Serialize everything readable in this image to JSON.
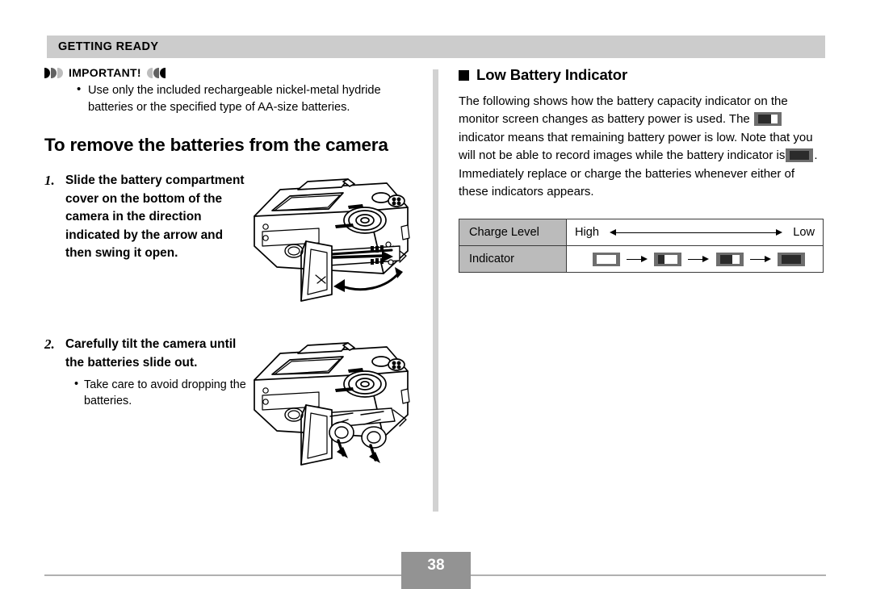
{
  "header": {
    "title": "GETTING READY"
  },
  "left_column": {
    "important": {
      "label": "IMPORTANT!",
      "bullets": [
        "Use only the included rechargeable nickel-metal hydride batteries or the specified type of AA-size batteries."
      ]
    },
    "section_heading": "To remove the batteries from the camera",
    "steps": [
      {
        "number": "1.",
        "text": "Slide the battery compartment cover on the bottom of the camera in the direction indicated by the arrow and then swing it open.",
        "sub": "",
        "illustration": "camera-battery-cover-open-illustration"
      },
      {
        "number": "2.",
        "text": "Carefully tilt the camera until the batteries slide out.",
        "sub": "Take care to avoid dropping the batteries.",
        "illustration": "camera-batteries-sliding-out-illustration"
      }
    ]
  },
  "right_column": {
    "heading": "Low Battery Indicator",
    "paragraph_parts": {
      "p1": "The following shows how the battery capacity indicator on the monitor screen changes as battery power is used. The",
      "p2": "indicator means that remaining battery power is low. Note that you will not be able to record images while the battery indicator is",
      "p3": ". Immediately replace or charge the batteries whenever either of these indicators appears."
    },
    "table": {
      "rows": [
        {
          "label": "Charge Level",
          "high": "High",
          "low": "Low"
        },
        {
          "label": "Indicator"
        }
      ],
      "indicators": [
        {
          "name": "battery-full-icon",
          "fill": 0
        },
        {
          "name": "battery-two-thirds-icon",
          "fill": 33
        },
        {
          "name": "battery-one-third-icon",
          "fill": 66
        },
        {
          "name": "battery-empty-icon",
          "fill": 100
        }
      ]
    }
  },
  "footer": {
    "page_number": "38"
  },
  "colors": {
    "header_bar": "#cccccc",
    "table_label_bg": "#bbbbbb",
    "divider": "#d2d2d2",
    "page_badge": "#939393",
    "battery_body": "#6e6e6e",
    "battery_fill": "#2b2b2b"
  }
}
